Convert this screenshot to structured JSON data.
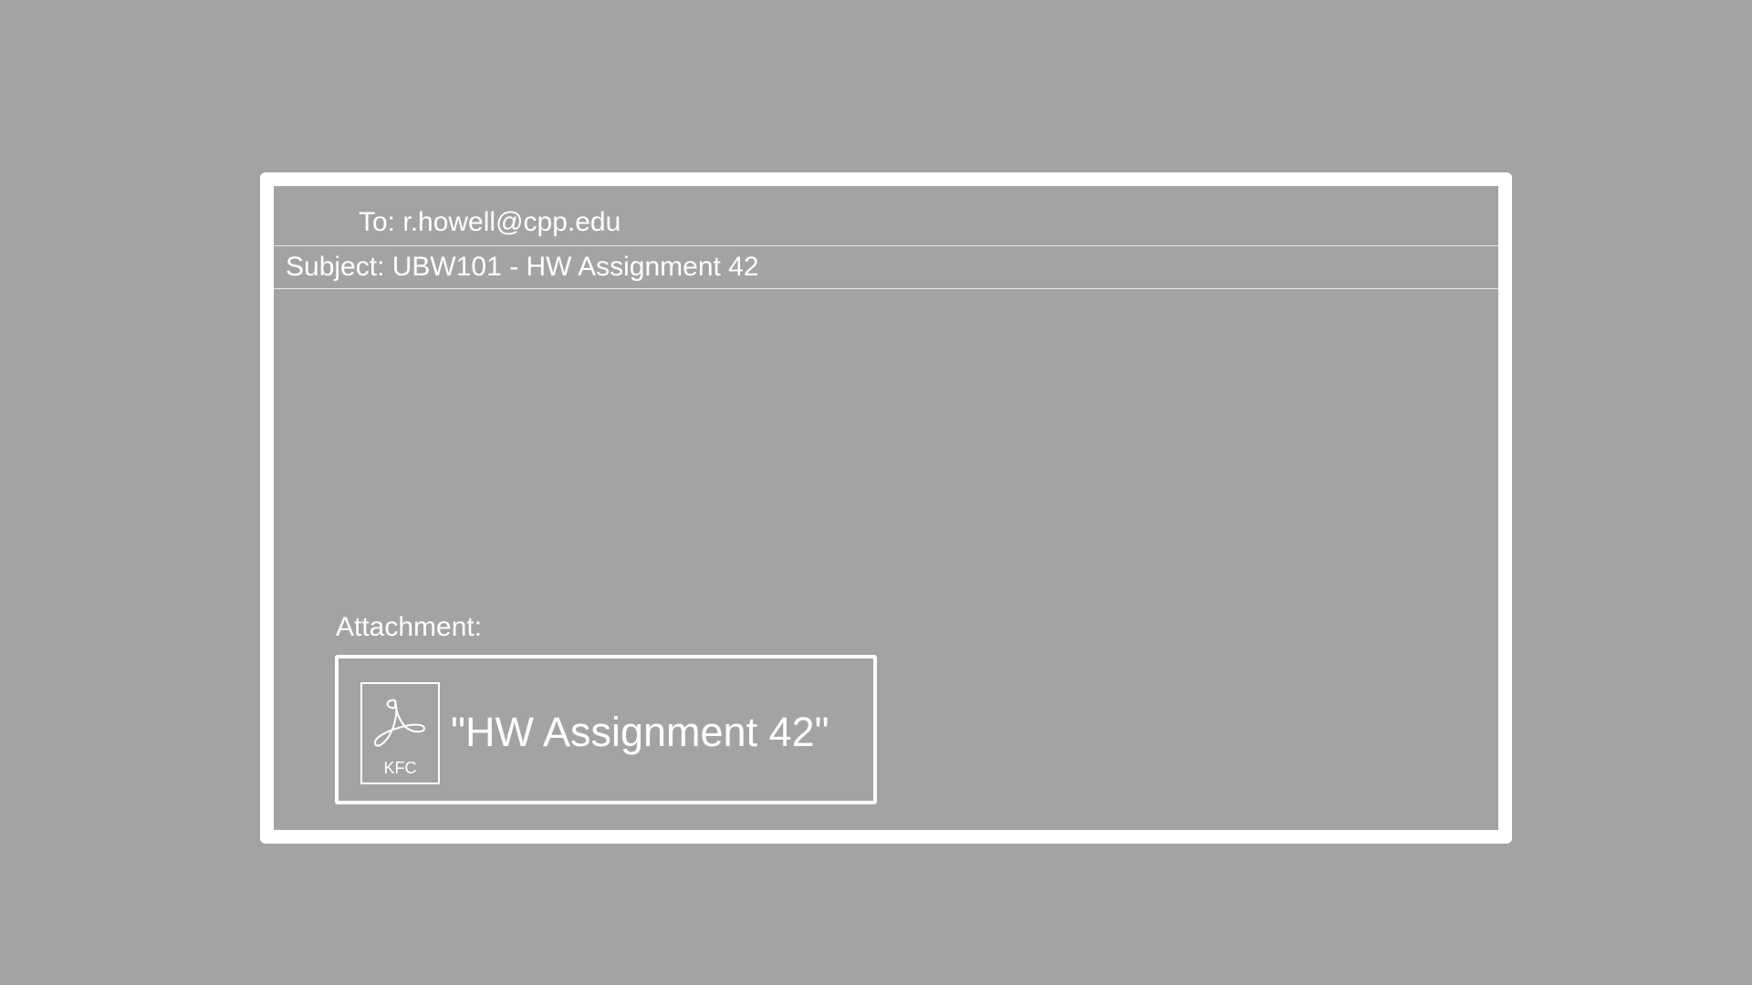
{
  "email": {
    "to_label": "To: r.howell@cpp.edu",
    "subject_label": "Subject: UBW101 - HW Assignment 42",
    "body": ""
  },
  "attachment": {
    "label": "Attachment:",
    "file_name": "\"HW Assignment 42\"",
    "icon": "pdf-file-icon",
    "icon_caption": "KFC"
  },
  "colors": {
    "background": "#a3a3a3",
    "foreground": "#ffffff"
  }
}
